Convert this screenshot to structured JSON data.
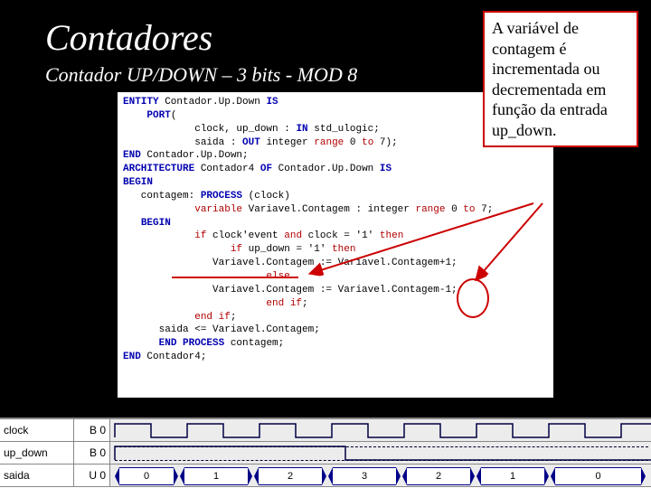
{
  "title": "Contadores",
  "subtitle": "Contador UP/DOWN – 3 bits - MOD 8",
  "callout": "A variável de contagem é incrementada ou decrementada em função da entrada up_down.",
  "code": {
    "l1a": "ENTITY",
    "l1b": " Contador.Up.Down ",
    "l1c": "IS",
    "l2a": "PORT",
    "l2b": "(",
    "l3a": "            clock, up_down : ",
    "l3b": "IN",
    "l3c": " std_ulogic;",
    "l4a": "            saida : ",
    "l4b": "OUT",
    "l4c": " integer ",
    "l4d": "range",
    "l4e": " 0 ",
    "l4f": "to",
    "l4g": " 7);",
    "l5a": "END",
    "l5b": " Contador.Up.Down;",
    "l6": "",
    "l7a": "ARCHITECTURE",
    "l7b": " Contador4 ",
    "l7c": "OF",
    "l7d": " Contador.Up.Down ",
    "l7e": "IS",
    "l8a": "BEGIN",
    "l9": "",
    "l10a": "   contagem: ",
    "l10b": "PROCESS",
    "l10c": " (clock)",
    "l11a": "      variable",
    "l11b": " Variavel.Contagem : integer ",
    "l11c": "range",
    "l11d": " 0 ",
    "l11e": "to",
    "l11f": " 7;",
    "l12a": "BEGIN",
    "l13a": "      if",
    "l13b": " clock'event ",
    "l13c": "and",
    "l13d": " clock = '1' ",
    "l13e": "then",
    "l14a": "         if",
    "l14b": " up_down = '1' ",
    "l14c": "then",
    "l15": "               Variavel.Contagem := Variavel.Contagem+1;",
    "l16a": "            else",
    "l17": "               Variavel.Contagem := Variavel.Contagem-1;",
    "l18a": "            end if",
    "l18b": ";",
    "l19a": "      end if",
    "l19b": ";",
    "l20": "      saida <= Variavel.Contagem;",
    "l21a": "   END PROCESS",
    "l21b": " contagem;",
    "l22a": "END",
    "l22b": " Contador4;"
  },
  "waveform": {
    "signals": [
      {
        "name": "clock",
        "type": "B 0"
      },
      {
        "name": "up_down",
        "type": "B 0"
      },
      {
        "name": "saida",
        "type": "U 0"
      }
    ],
    "saida_values": [
      "0",
      "1",
      "2",
      "3",
      "2",
      "1",
      "0"
    ]
  }
}
